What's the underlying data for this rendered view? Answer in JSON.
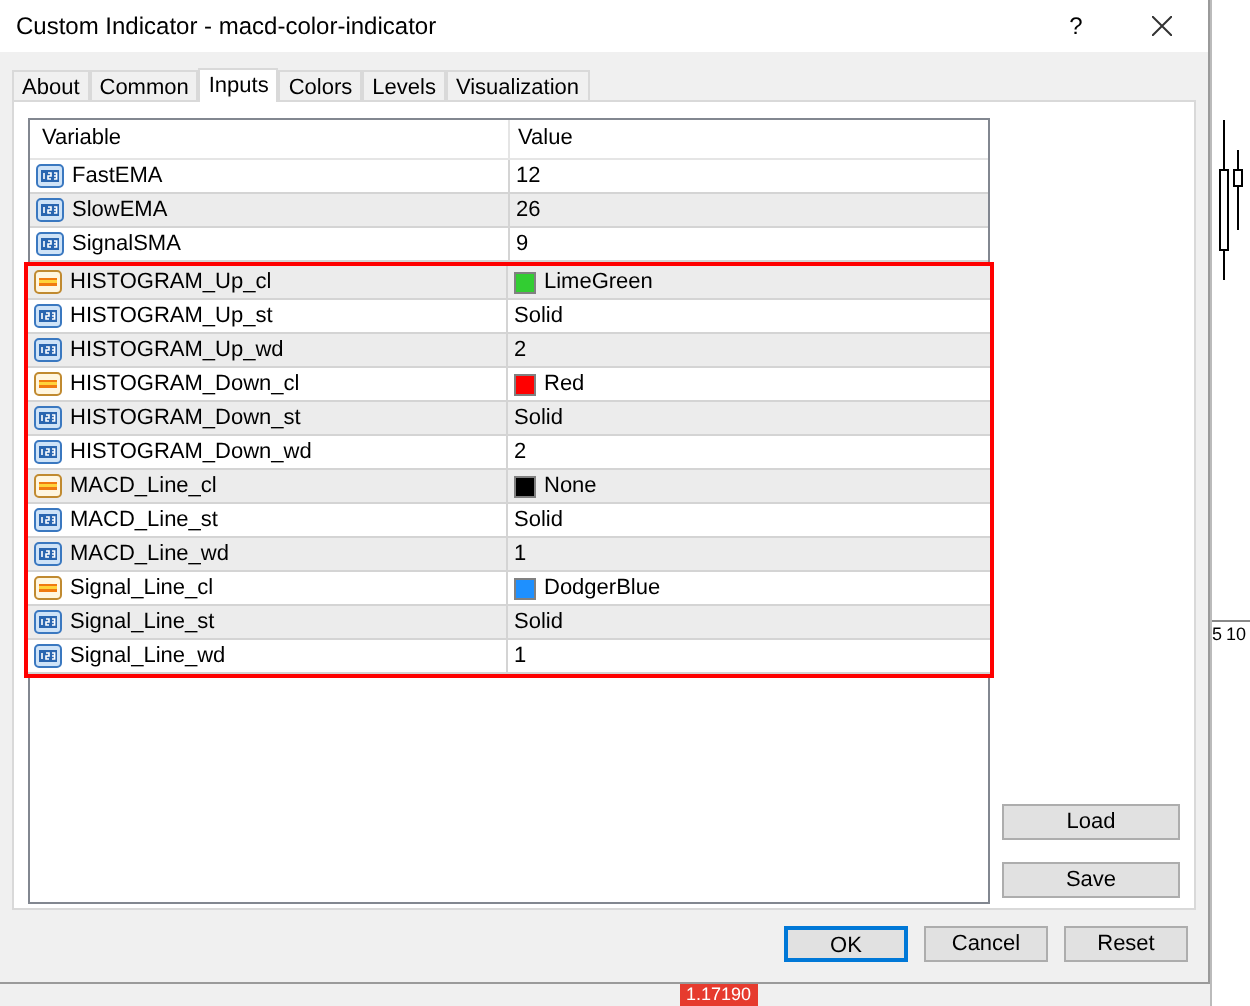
{
  "window": {
    "title": "Custom Indicator - macd-color-indicator",
    "help": "?"
  },
  "tabs": [
    {
      "label": "About",
      "selected": false
    },
    {
      "label": "Common",
      "selected": false
    },
    {
      "label": "Inputs",
      "selected": true
    },
    {
      "label": "Colors",
      "selected": false
    },
    {
      "label": "Levels",
      "selected": false
    },
    {
      "label": "Visualization",
      "selected": false
    }
  ],
  "table": {
    "columns": [
      "Variable",
      "Value"
    ],
    "rows": [
      {
        "kind": "number",
        "variable": "FastEMA",
        "value": "12"
      },
      {
        "kind": "number",
        "variable": "SlowEMA",
        "value": "26"
      },
      {
        "kind": "number",
        "variable": "SignalSMA",
        "value": "9"
      }
    ],
    "highlighted_rows": [
      {
        "kind": "color",
        "variable": "HISTOGRAM_Up_cl",
        "value": "LimeGreen",
        "color": "#32cd32"
      },
      {
        "kind": "number",
        "variable": "HISTOGRAM_Up_st",
        "value": "Solid"
      },
      {
        "kind": "number",
        "variable": "HISTOGRAM_Up_wd",
        "value": "2"
      },
      {
        "kind": "color",
        "variable": "HISTOGRAM_Down_cl",
        "value": "Red",
        "color": "#ff0000"
      },
      {
        "kind": "number",
        "variable": "HISTOGRAM_Down_st",
        "value": "Solid"
      },
      {
        "kind": "number",
        "variable": "HISTOGRAM_Down_wd",
        "value": "2"
      },
      {
        "kind": "color",
        "variable": "MACD_Line_cl",
        "value": "None",
        "color": "#000000"
      },
      {
        "kind": "number",
        "variable": "MACD_Line_st",
        "value": "Solid"
      },
      {
        "kind": "number",
        "variable": "MACD_Line_wd",
        "value": "1"
      },
      {
        "kind": "color",
        "variable": "Signal_Line_cl",
        "value": "DodgerBlue",
        "color": "#1e90ff"
      },
      {
        "kind": "number",
        "variable": "Signal_Line_st",
        "value": "Solid"
      },
      {
        "kind": "number",
        "variable": "Signal_Line_wd",
        "value": "1"
      }
    ]
  },
  "side_buttons": [
    "Load",
    "Save"
  ],
  "buttons": [
    {
      "label": "OK",
      "default": true
    },
    {
      "label": "Cancel",
      "default": false
    },
    {
      "label": "Reset",
      "default": false
    }
  ],
  "background_chart": {
    "scale_labels": [
      "5",
      "10"
    ],
    "price_label": "1.17190"
  }
}
